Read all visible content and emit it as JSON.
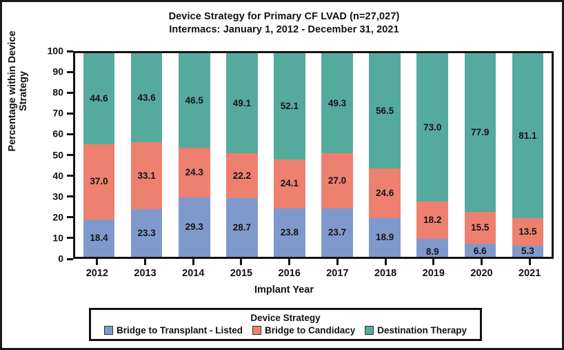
{
  "chart_data": {
    "type": "bar",
    "stacked": true,
    "title": "Device Strategy for Primary CF LVAD (n=27,027)",
    "subtitle": "Intermacs: January 1, 2012 - December 31, 2021",
    "xlabel": "Implant Year",
    "ylabel": "Percentage within Device Strategy",
    "ylim": [
      0,
      100
    ],
    "yticks": [
      0,
      10,
      20,
      30,
      40,
      50,
      60,
      70,
      80,
      90,
      100
    ],
    "grid": false,
    "legend_position": "bottom",
    "legend_title": "Device Strategy",
    "categories": [
      "2012",
      "2013",
      "2014",
      "2015",
      "2016",
      "2017",
      "2018",
      "2019",
      "2020",
      "2021"
    ],
    "series": [
      {
        "name": "Bridge to Transplant - Listed",
        "color": "#8099cc",
        "values": [
          18.4,
          23.3,
          29.3,
          28.7,
          23.8,
          23.7,
          18.9,
          8.9,
          6.6,
          5.3
        ]
      },
      {
        "name": "Bridge to Candidacy",
        "color": "#ee8070",
        "values": [
          37.0,
          33.1,
          24.3,
          22.2,
          24.1,
          27.0,
          24.6,
          18.2,
          15.5,
          13.5
        ]
      },
      {
        "name": "Destination Therapy",
        "color": "#55aa9e",
        "values": [
          44.6,
          43.6,
          46.5,
          49.1,
          52.1,
          49.3,
          56.5,
          73.0,
          77.9,
          81.1
        ]
      }
    ]
  }
}
